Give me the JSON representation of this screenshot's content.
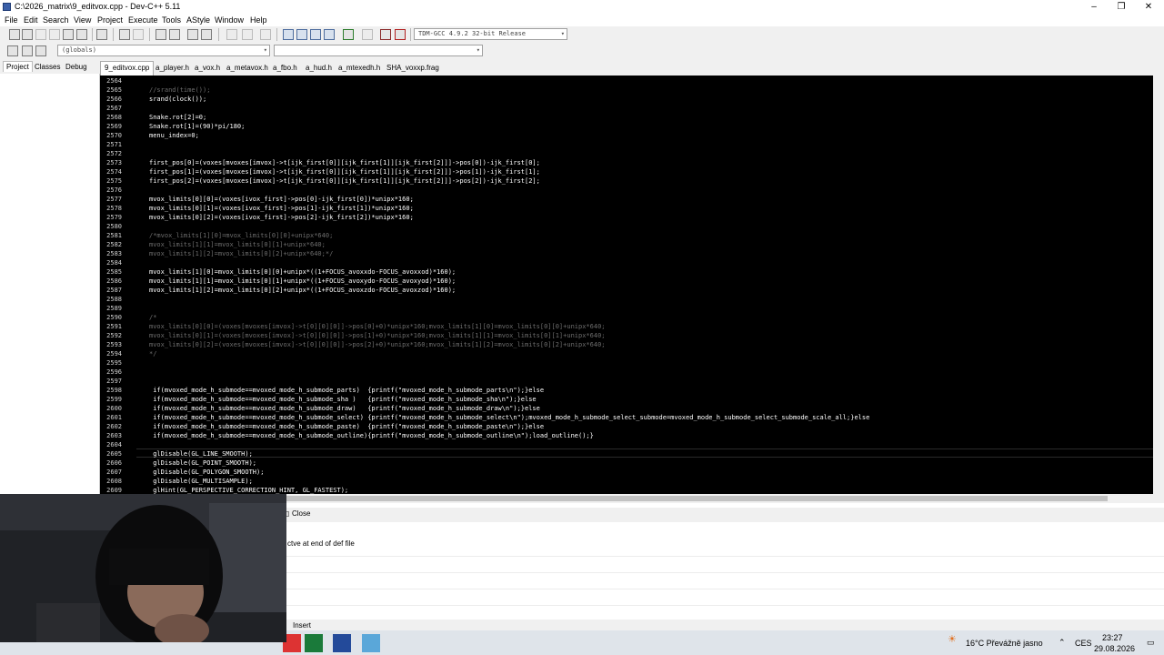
{
  "window": {
    "title": "C:\\2026_matrix\\9_editvox.cpp - Dev-C++ 5.11"
  },
  "menu": [
    "File",
    "Edit",
    "Search",
    "View",
    "Project",
    "Execute",
    "Tools",
    "AStyle",
    "Window",
    "Help"
  ],
  "toolbar": {
    "compiler": "TDM-GCC 4.9.2 32-bit Release",
    "scope": "(globals)"
  },
  "left_tabs": [
    "Project",
    "Classes",
    "Debug"
  ],
  "file_tabs": [
    "9_editvox.cpp",
    "a_player.h",
    "a_vox.h",
    "a_metavox.h",
    "a_fbo.h",
    "a_hud.h",
    "a_mtexedh.h",
    "SHA_voxxp.frag"
  ],
  "code": [
    {
      "n": "2564",
      "t": ""
    },
    {
      "n": "2565",
      "t": "//srand(time());",
      "c": "cm"
    },
    {
      "n": "2566",
      "t": "srand(clock());"
    },
    {
      "n": "2567",
      "t": ""
    },
    {
      "n": "2568",
      "t": "Snake.rot[2]=0;"
    },
    {
      "n": "2569",
      "t": "Snake.rot[1]=(90)*pi/180;"
    },
    {
      "n": "2570",
      "t": "menu_index=0;"
    },
    {
      "n": "2571",
      "t": ""
    },
    {
      "n": "2572",
      "t": ""
    },
    {
      "n": "2573",
      "t": "first_pos[0]=(voxes[mvoxes[imvox]->t[ijk_first[0]][ijk_first[1]][ijk_first[2]]]->pos[0])-ijk_first[0];"
    },
    {
      "n": "2574",
      "t": "first_pos[1]=(voxes[mvoxes[imvox]->t[ijk_first[0]][ijk_first[1]][ijk_first[2]]]->pos[1])-ijk_first[1];"
    },
    {
      "n": "2575",
      "t": "first_pos[2]=(voxes[mvoxes[imvox]->t[ijk_first[0]][ijk_first[1]][ijk_first[2]]]->pos[2])-ijk_first[2];"
    },
    {
      "n": "2576",
      "t": ""
    },
    {
      "n": "2577",
      "t": "mvox_limits[0][0]=(voxes[ivox_first]->pos[0]-ijk_first[0])*unipx*160;"
    },
    {
      "n": "2578",
      "t": "mvox_limits[0][1]=(voxes[ivox_first]->pos[1]-ijk_first[1])*unipx*160;"
    },
    {
      "n": "2579",
      "t": "mvox_limits[0][2]=(voxes[ivox_first]->pos[2]-ijk_first[2])*unipx*160;"
    },
    {
      "n": "2580",
      "t": ""
    },
    {
      "n": "2581",
      "t": "/*mvox_limits[1][0]=mvox_limits[0][0]+unipx*640;",
      "c": "cm"
    },
    {
      "n": "2582",
      "t": "mvox_limits[1][1]=mvox_limits[0][1]+unipx*640;",
      "c": "cm"
    },
    {
      "n": "2583",
      "t": "mvox_limits[1][2]=mvox_limits[0][2]+unipx*640;*/",
      "c": "cm"
    },
    {
      "n": "2584",
      "t": ""
    },
    {
      "n": "2585",
      "t": "mvox_limits[1][0]=mvox_limits[0][0]+unipx*((1+FOCUS_avoxxdo-FOCUS_avoxxod)*160);"
    },
    {
      "n": "2586",
      "t": "mvox_limits[1][1]=mvox_limits[0][1]+unipx*((1+FOCUS_avoxydo-FOCUS_avoxyod)*160);"
    },
    {
      "n": "2587",
      "t": "mvox_limits[1][2]=mvox_limits[0][2]+unipx*((1+FOCUS_avoxzdo-FOCUS_avoxzod)*160);"
    },
    {
      "n": "2588",
      "t": ""
    },
    {
      "n": "2589",
      "t": ""
    },
    {
      "n": "2590",
      "t": "/*",
      "c": "cm"
    },
    {
      "n": "2591",
      "t": "mvox_limits[0][0]=(voxes[mvoxes[imvox]->t[0][0][0]]->pos[0]+0)*unipx*160;mvox_limits[1][0]=mvox_limits[0][0]+unipx*640;",
      "c": "cm"
    },
    {
      "n": "2592",
      "t": "mvox_limits[0][1]=(voxes[mvoxes[imvox]->t[0][0][0]]->pos[1]+0)*unipx*160;mvox_limits[1][1]=mvox_limits[0][1]+unipx*640;",
      "c": "cm"
    },
    {
      "n": "2593",
      "t": "mvox_limits[0][2]=(voxes[mvoxes[imvox]->t[0][0][0]]->pos[2]+0)*unipx*160;mvox_limits[1][2]=mvox_limits[0][2]+unipx*640;",
      "c": "cm"
    },
    {
      "n": "2594",
      "t": "*/",
      "c": "cm"
    },
    {
      "n": "2595",
      "t": ""
    },
    {
      "n": "2596",
      "t": ""
    },
    {
      "n": "2597",
      "t": ""
    },
    {
      "n": "2598",
      "t": " if(mvoxed_mode_h_submode==mvoxed_mode_h_submode_parts)  {printf(\"mvoxed_mode_h_submode_parts\\n\");}else"
    },
    {
      "n": "2599",
      "t": " if(mvoxed_mode_h_submode==mvoxed_mode_h_submode_sha )   {printf(\"mvoxed_mode_h_submode_sha\\n\");}else"
    },
    {
      "n": "2600",
      "t": " if(mvoxed_mode_h_submode==mvoxed_mode_h_submode_draw)   {printf(\"mvoxed_mode_h_submode_draw\\n\");}else"
    },
    {
      "n": "2601",
      "t": " if(mvoxed_mode_h_submode==mvoxed_mode_h_submode_select) {printf(\"mvoxed_mode_h_submode_select\\n\");mvoxed_mode_h_submode_select_submode=mvoxed_mode_h_submode_select_submode_scale_all;}else"
    },
    {
      "n": "2602",
      "t": " if(mvoxed_mode_h_submode==mvoxed_mode_h_submode_paste)  {printf(\"mvoxed_mode_h_submode_paste\\n\");}else"
    },
    {
      "n": "2603",
      "t": " if(mvoxed_mode_h_submode==mvoxed_mode_h_submode_outline){printf(\"mvoxed_mode_h_submode_outline\\n\");load_outline();}"
    },
    {
      "n": "2604",
      "t": ""
    },
    {
      "n": "2605",
      "t": " glDisable(GL_LINE_SMOOTH);"
    },
    {
      "n": "2606",
      "t": " glDisable(GL_POINT_SMOOTH);"
    },
    {
      "n": "2607",
      "t": " glDisable(GL_POLYGON_SMOOTH);"
    },
    {
      "n": "2608",
      "t": " glDisable(GL_MULTISAMPLE);"
    },
    {
      "n": "2609",
      "t": " glHint(GL_PERSPECTIVE_CORRECTION_HINT, GL_FASTEST);"
    }
  ],
  "bottom": {
    "close_label": "Close",
    "message": "ctve at end of def file"
  },
  "status": {
    "mode": "Insert"
  },
  "tray": {
    "weather": "16°C  Převážně jasno",
    "lang": "CES",
    "time": "23:27",
    "date": "29.08.2026"
  }
}
